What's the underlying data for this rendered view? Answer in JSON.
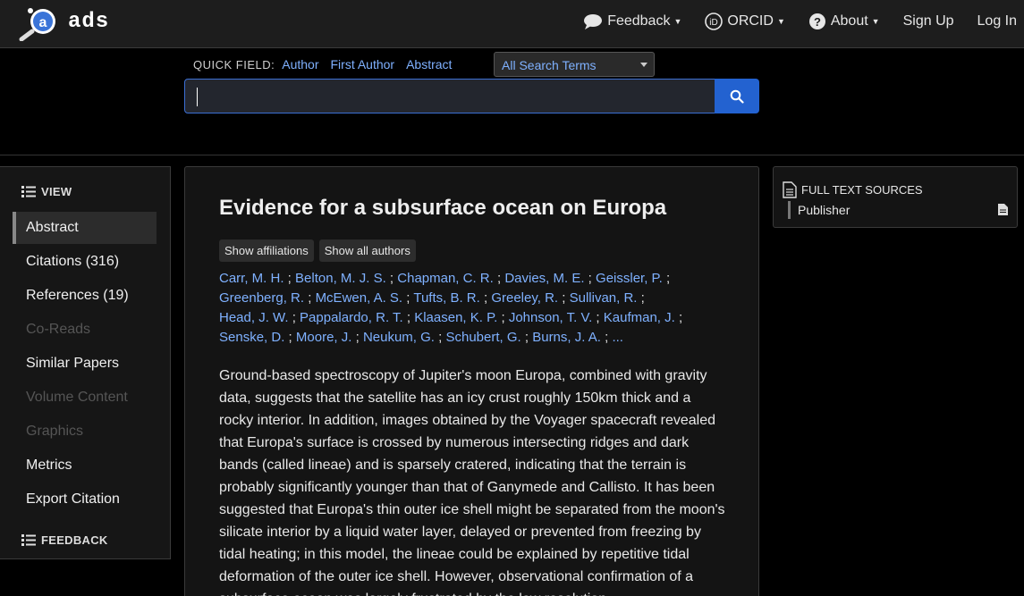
{
  "header": {
    "logo_text": "ads",
    "nav": [
      {
        "label": "Feedback"
      },
      {
        "label": "ORCID"
      },
      {
        "label": "About"
      },
      {
        "label": "Sign Up"
      },
      {
        "label": "Log In"
      }
    ]
  },
  "search": {
    "quick_field_label": "QUICK FIELD:",
    "links": [
      "Author",
      "First Author",
      "Abstract"
    ],
    "select_value": "All Search Terms",
    "query": ""
  },
  "sidebar": {
    "view_heading": "VIEW",
    "items": [
      {
        "label": "Abstract",
        "state": "active"
      },
      {
        "label": "Citations (316)",
        "state": "normal"
      },
      {
        "label": "References (19)",
        "state": "normal"
      },
      {
        "label": "Co-Reads",
        "state": "disabled"
      },
      {
        "label": "Similar Papers",
        "state": "normal"
      },
      {
        "label": "Volume Content",
        "state": "disabled"
      },
      {
        "label": "Graphics",
        "state": "disabled"
      },
      {
        "label": "Metrics",
        "state": "normal"
      },
      {
        "label": "Export Citation",
        "state": "normal"
      }
    ],
    "feedback_heading": "FEEDBACK"
  },
  "paper": {
    "title": "Evidence for a subsurface ocean on Europa",
    "show_affiliations": "Show affiliations",
    "show_all_authors": "Show all authors",
    "authors": [
      "Carr, M. H.",
      "Belton, M. J. S.",
      "Chapman, C. R.",
      "Davies, M. E.",
      "Geissler, P.",
      "Greenberg, R.",
      "McEwen, A. S.",
      "Tufts, B. R.",
      "Greeley, R.",
      "Sullivan, R.",
      "Head, J. W.",
      "Pappalardo, R. T.",
      "Klaasen, K. P.",
      "Johnson, T. V.",
      "Kaufman, J.",
      "Senske, D.",
      "Moore, J.",
      "Neukum, G.",
      "Schubert, G.",
      "Burns, J. A."
    ],
    "authors_more": "...",
    "abstract": "Ground-based spectroscopy of Jupiter's moon Europa, combined with gravity data, suggests that the satellite has an icy crust roughly 150km thick and a rocky interior. In addition, images obtained by the Voyager spacecraft revealed that Europa's surface is crossed by numerous intersecting ridges and dark bands (called lineae) and is sparsely cratered, indicating that the terrain is probably significantly younger than that of Ganymede and Callisto. It has been suggested that Europa's thin outer ice shell might be separated from the moon's silicate interior by a liquid water layer, delayed or prevented from freezing by tidal heating; in this model, the lineae could be explained by repetitive tidal deformation of the outer ice shell. However, observational confirmation of a subsurface ocean was largely frustrated by the low resolution"
  },
  "full_text": {
    "heading": "FULL TEXT SOURCES",
    "items": [
      {
        "label": "Publisher"
      }
    ]
  },
  "colors": {
    "link": "#7fb1ff",
    "search_button": "#2362d0"
  }
}
